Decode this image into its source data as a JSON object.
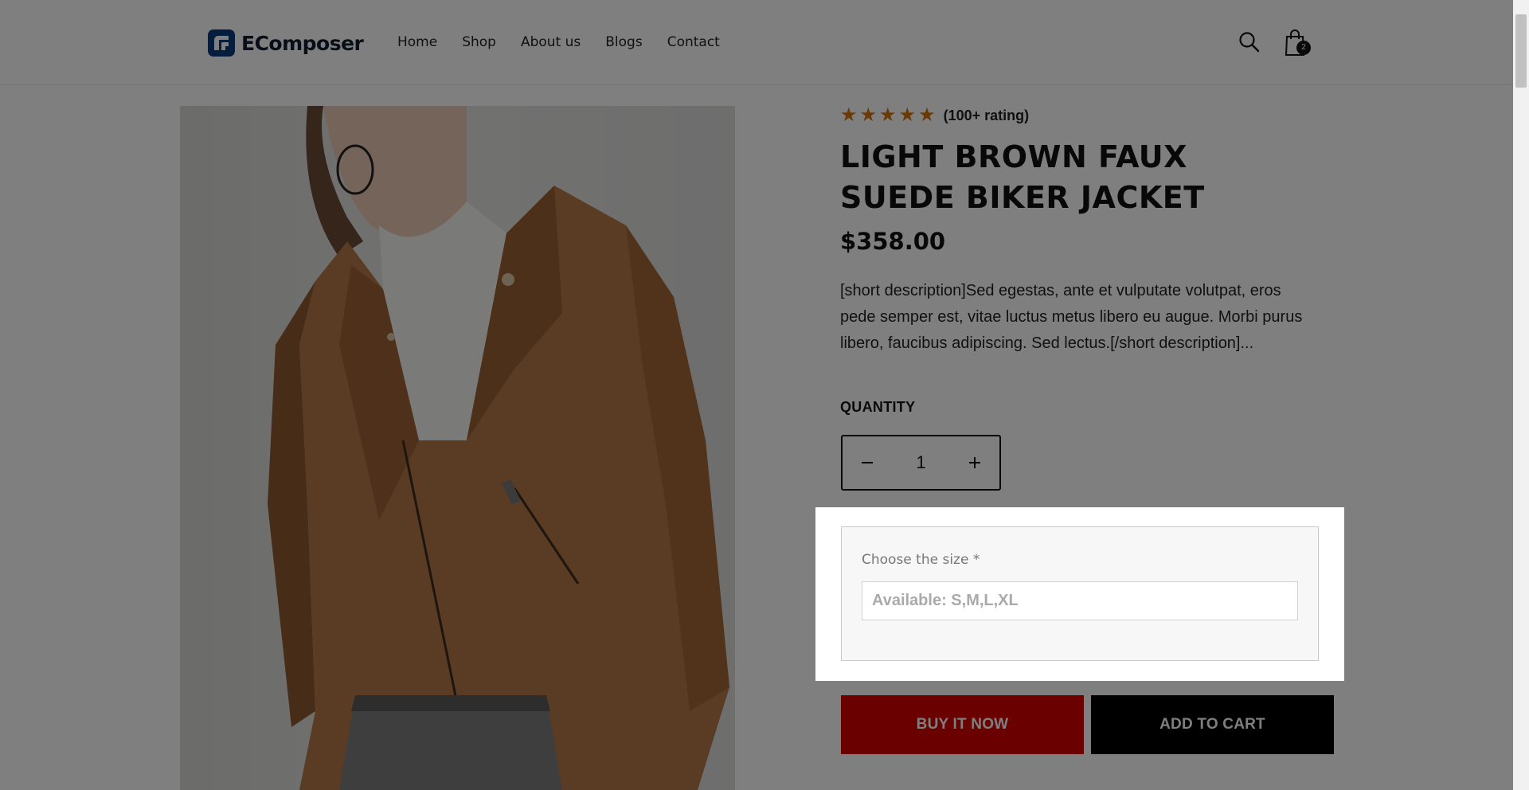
{
  "brand": {
    "name": "EComposer",
    "color": "#0b3d7a"
  },
  "nav": {
    "items": [
      "Home",
      "Shop",
      "About us",
      "Blogs",
      "Contact"
    ]
  },
  "header": {
    "cart_count": "2"
  },
  "product": {
    "rating_text": "(100+ rating)",
    "rating_stars": 5,
    "title": "LIGHT BROWN FAUX SUEDE BIKER JACKET",
    "price": "$358.00",
    "description": "[short description]Sed egestas, ante et vulputate volutpat, eros pede semper est, vitae luctus metus libero eu augue. Morbi purus libero, faucibus adipiscing. Sed lectus.[/short description]...",
    "quantity_label": "QUANTITY",
    "quantity": "1"
  },
  "size_form": {
    "label": "Choose the size *",
    "placeholder": "Available: S,M,L,XL"
  },
  "buttons": {
    "buy_now": "BUY IT NOW",
    "add_to_cart": "ADD TO CART"
  },
  "colors": {
    "star": "#d5750c",
    "buy_button": "#d60000",
    "cart_button": "#000000"
  }
}
